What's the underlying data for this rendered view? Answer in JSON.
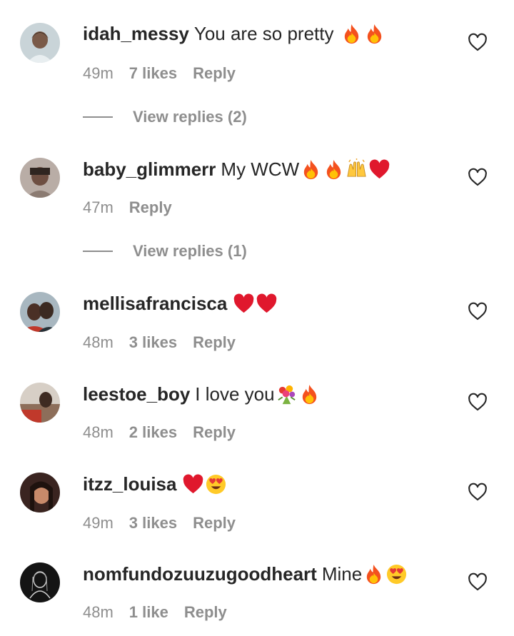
{
  "comments": [
    {
      "username": "idah_messy",
      "text": "You are so pretty",
      "emojis": [
        "fire",
        "fire"
      ],
      "time": "49m",
      "likes": "7 likes",
      "reply_label": "Reply",
      "view_replies": "View replies (2)"
    },
    {
      "username": "baby_glimmerr",
      "text": "My WCW",
      "emojis": [
        "fire",
        "fire",
        "raised-hands",
        "red-heart"
      ],
      "time": "47m",
      "likes": "",
      "reply_label": "Reply",
      "view_replies": "View replies (1)"
    },
    {
      "username": "mellisafrancisca",
      "text": "",
      "emojis": [
        "red-heart",
        "red-heart"
      ],
      "time": "48m",
      "likes": "3 likes",
      "reply_label": "Reply"
    },
    {
      "username": "leestoe_boy",
      "text": "I love you",
      "emojis": [
        "bouquet",
        "fire"
      ],
      "time": "48m",
      "likes": "2 likes",
      "reply_label": "Reply"
    },
    {
      "username": "itzz_louisa",
      "text": "",
      "emojis": [
        "red-heart",
        "heart-eyes"
      ],
      "time": "49m",
      "likes": "3 likes",
      "reply_label": "Reply"
    },
    {
      "username": "nomfundozuuzugoodheart",
      "text": "Mine",
      "emojis": [
        "fire",
        "heart-eyes"
      ],
      "time": "48m",
      "likes": "1 like",
      "reply_label": "Reply"
    }
  ],
  "colors": {
    "primary_text": "#262626",
    "secondary_text": "#8e8e8e",
    "heart_outline": "#262626"
  }
}
